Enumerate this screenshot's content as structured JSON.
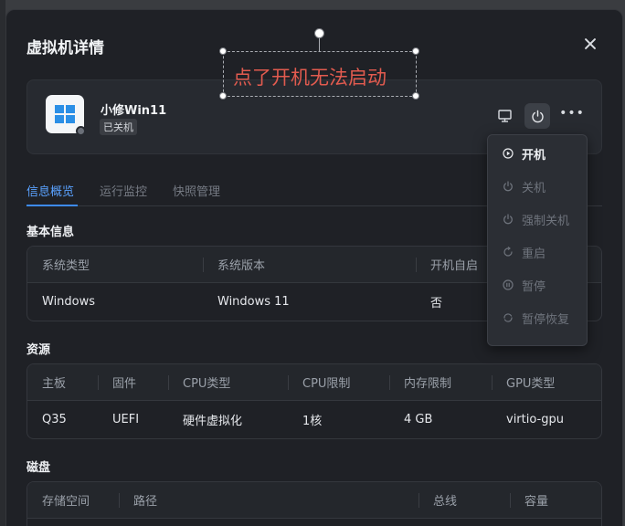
{
  "dialog": {
    "title": "虚拟机详情"
  },
  "annotation": {
    "text": "点了开机无法启动",
    "color": "#e25b4f"
  },
  "vm": {
    "name": "小修Win11",
    "status": "已关机",
    "logo": "windows-logo-icon"
  },
  "tabs": [
    {
      "label": "信息概览",
      "active": true
    },
    {
      "label": "运行监控",
      "active": false
    },
    {
      "label": "快照管理",
      "active": false
    }
  ],
  "basic_info": {
    "title": "基本信息",
    "headers": [
      "系统类型",
      "系统版本",
      "开机自启"
    ],
    "values": [
      "Windows",
      "Windows 11",
      "否"
    ]
  },
  "resources": {
    "title": "资源",
    "headers": [
      "主板",
      "固件",
      "CPU类型",
      "CPU限制",
      "内存限制",
      "GPU类型"
    ],
    "values": [
      "Q35",
      "UEFI",
      "硬件虚拟化",
      "1核",
      "4 GB",
      "virtio-gpu"
    ]
  },
  "disk": {
    "title": "磁盘",
    "headers": [
      "存储空间",
      "路径",
      "总线",
      "容量"
    ]
  },
  "power_menu": [
    {
      "label": "开机",
      "icon": "play-circle-icon",
      "enabled": true
    },
    {
      "label": "关机",
      "icon": "power-icon",
      "enabled": false
    },
    {
      "label": "强制关机",
      "icon": "power-icon",
      "enabled": false
    },
    {
      "label": "重启",
      "icon": "restart-icon",
      "enabled": false
    },
    {
      "label": "暂停",
      "icon": "pause-circle-icon",
      "enabled": false
    },
    {
      "label": "暂停恢复",
      "icon": "resume-icon",
      "enabled": false
    }
  ],
  "colors": {
    "accent": "#3d8bf5",
    "dialog_bg": "#1f2126",
    "card_bg": "#272a30"
  }
}
